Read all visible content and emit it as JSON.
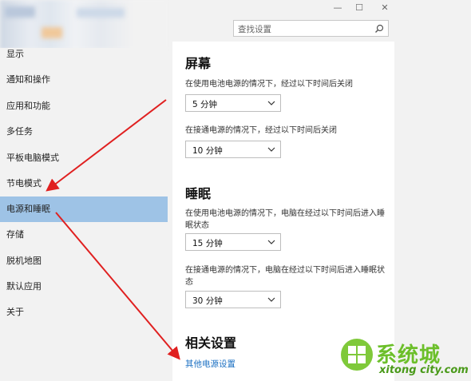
{
  "window": {
    "minimize": "—",
    "maximize": "☐",
    "close": "✕"
  },
  "search": {
    "placeholder": "查找设置"
  },
  "sidebar": {
    "items": [
      {
        "label": "显示"
      },
      {
        "label": "通知和操作"
      },
      {
        "label": "应用和功能"
      },
      {
        "label": "多任务"
      },
      {
        "label": "平板电脑模式"
      },
      {
        "label": "节电模式"
      },
      {
        "label": "电源和睡眠",
        "active": true
      },
      {
        "label": "存储"
      },
      {
        "label": "脱机地图"
      },
      {
        "label": "默认应用"
      },
      {
        "label": "关于"
      }
    ]
  },
  "screen": {
    "heading": "屏幕",
    "battery_label": "在使用电池电源的情况下，经过以下时间后关闭",
    "battery_value": "5 分钟",
    "plugged_label": "在接通电源的情况下，经过以下时间后关闭",
    "plugged_value": "10 分钟"
  },
  "sleep": {
    "heading": "睡眠",
    "battery_label": "在使用电池电源的情况下，电脑在经过以下时间后进入睡眠状态",
    "battery_value": "15 分钟",
    "plugged_label": "在接通电源的情况下，电脑在经过以下时间后进入睡眠状态",
    "plugged_value": "30 分钟"
  },
  "related": {
    "heading": "相关设置",
    "link": "其他电源设置"
  },
  "watermark": {
    "word": "系统城",
    "sub": "xitong city.com"
  },
  "colors": {
    "accent_active": "#9ec3e6",
    "link": "#1a6fc2",
    "arrow": "#e02020",
    "logo_green": "#6cbf2a"
  }
}
